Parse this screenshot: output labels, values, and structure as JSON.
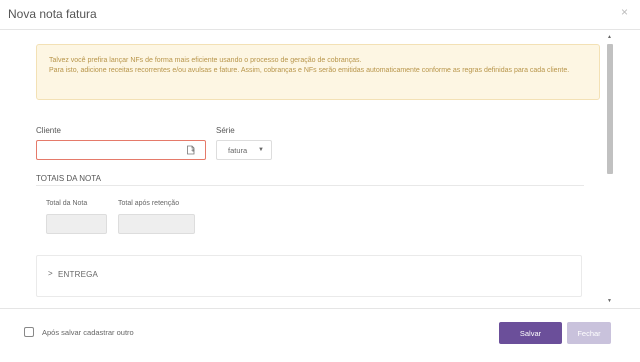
{
  "modal": {
    "title": "Nova nota fatura",
    "close_symbol": "×"
  },
  "alert": {
    "line1": "Talvez você prefira lançar NFs de forma mais eficiente usando o processo de geração de cobranças.",
    "line2": "Para isto, adicione receitas recorrentes e/ou avulsas e fature. Assim, cobranças e NFs serão emitidas automaticamente conforme as regras definidas para cada cliente."
  },
  "form": {
    "cliente_label": "Cliente",
    "cliente_value": "",
    "cliente_icon": "add-client-icon",
    "serie_label": "Série",
    "serie_value": "fatura",
    "serie_caret": "▼"
  },
  "totais": {
    "section_title": "TOTAIS DA NOTA",
    "total_label": "Total da Nota",
    "total_value": "",
    "retencao_label": "Total após retenção",
    "retencao_value": ""
  },
  "entrega": {
    "chevron": ">",
    "label": "ENTREGA"
  },
  "footer": {
    "checkbox_label": "Após salvar cadastrar outro",
    "checkbox_checked": false,
    "save_label": "Salvar",
    "close_label": "Fechar"
  },
  "colors": {
    "primary": "#6b4f9a",
    "primary_disabled": "#c9c2dc",
    "alert_bg": "#fdf6e3",
    "alert_text": "#b8954a",
    "error_border": "#e57a6a"
  }
}
